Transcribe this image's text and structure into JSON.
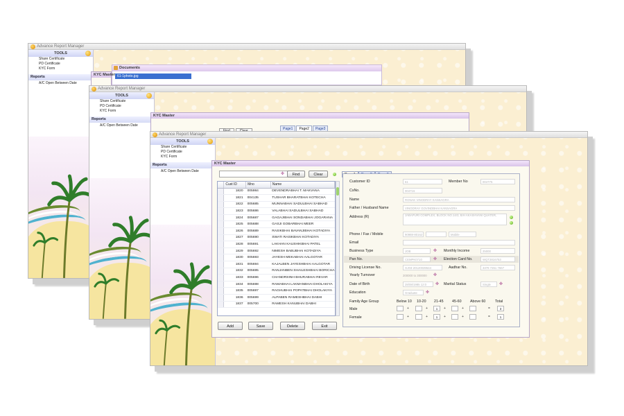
{
  "app_title": "Advance Report Manager",
  "tools": {
    "header": "TOOLS",
    "items": [
      "Share Certificate",
      "PD Certificate",
      "KYC Form"
    ]
  },
  "reports": {
    "header": "Reports",
    "items": [
      "A/C Open Between Date"
    ]
  },
  "documents_window": {
    "title": "Documents",
    "file": "61-1photo.jpg"
  },
  "kyc_title": "KYC Master",
  "tabs": [
    "Page1",
    "Page2",
    "Page3"
  ],
  "search": {
    "find_label": "Find",
    "clear_label": "Clear"
  },
  "grid": {
    "columns": [
      "Cust ID",
      "Mno",
      "Name"
    ],
    "rows": [
      [
        "1820",
        "005984",
        "DEVENDRABHAI T. MAKVANA"
      ],
      [
        "1821",
        "004135",
        "TUSHAR BHARATBHAI KOTECHA"
      ],
      [
        "1822",
        "005685",
        "MUNNABHAI SADULBHAI SABHAD"
      ],
      [
        "1823",
        "005686",
        "VALABHAI SADULBHAI SABHAD"
      ],
      [
        "1824",
        "005687",
        "GAGAJIBHAI SONDABHAI JOGARANA"
      ],
      [
        "1825",
        "005688",
        "GASJI GOBARBHAI MEER"
      ],
      [
        "1826",
        "005689",
        "RASIKBHAI BAVANJIBHAI KOTADIYA"
      ],
      [
        "1827",
        "005690",
        "SWATI RASIKBHAI KOTADIYA"
      ],
      [
        "1828",
        "005691",
        "LAKHAN KAUSHIKBHAI PATEL"
      ],
      [
        "1829",
        "005692",
        "NIMESH BABUBHAI KOTADIYA"
      ],
      [
        "1830",
        "005693",
        "JAYESH MEKABHAI AALGOTAR"
      ],
      [
        "1831",
        "005694",
        "KAJALBEN JAYESHBHAI AALGOTAR"
      ],
      [
        "1832",
        "005695",
        "RANJANBEN SHAILESHBHAI BORICHA"
      ],
      [
        "1833",
        "005696",
        "CHANDRSINH BHURABHAI REVAR"
      ],
      [
        "1834",
        "005698",
        "RAMABHAI LAKMANBHAI DHOLAKIYA"
      ],
      [
        "1835",
        "005697",
        "RAGHUBHAI POPATBHAI DHOLAKIYA"
      ],
      [
        "1836",
        "005699",
        "ALPABEN RAMESHBHAI DABHI"
      ],
      [
        "1837",
        "005700",
        "RAMESH KANUBHAI DABHI"
      ]
    ]
  },
  "buttons": {
    "add": "Add",
    "save": "Save",
    "delete": "Delete",
    "exit": "Exit"
  },
  "form": {
    "customer_id_label": "Customer ID",
    "customer_id_value": "61",
    "member_no_label": "Member No",
    "member_no_value": "004775",
    "csno_label": "CsNo.",
    "csno_value": "004716",
    "name_label": "Name",
    "name_value": "RONAK VINODRAY KANSAGRA",
    "father_label": "Father / Husband Name",
    "father_value": "VINODRAY GOVINDBHAI KANSAGRA",
    "address_label": "Address (R)",
    "address_value": "JABAPURI COMPLEX, BLOCK NO.14/3, B/H AKASHVANI QUATER,",
    "phone_label": "Phone / Fax / Mobile",
    "phone_value": "90988-80162",
    "mobile_placeholder": "Mobile",
    "email_label": "Email",
    "business_type_label": "Business Type",
    "business_type_value": "JOB",
    "monthly_income_label": "Monthly Income",
    "monthly_income_value": "25000",
    "pan_label": "Pan No.",
    "pan_value": "CEMPK0710",
    "election_label": "Election Card No.",
    "election_value": "WQT2816753",
    "driving_label": "Driving License No.",
    "driving_value": "GJ03-20120039644",
    "aadhar_label": "Aadhar No.",
    "aadhar_value": "3378 7261 7667",
    "turnover_label": "Yearly Turnover",
    "turnover_value": "200000 to 300000",
    "dob_label": "Date of Birth",
    "dob_value": "28/08/1985 12:0",
    "marital_label": "Marital Status",
    "marital_value": "Single",
    "education_label": "Education",
    "education_value": "Graduate",
    "family_group_label": "Family Age Group",
    "age_headers": [
      "Below 10",
      "10-20",
      "21-45",
      "45-60",
      "Above 60",
      "Total"
    ],
    "male_label": "Male",
    "female_label": "Female",
    "male_counts": [
      "",
      "",
      "1",
      "",
      "",
      "3"
    ],
    "female_counts": [
      "",
      "",
      "1",
      "",
      "",
      "1"
    ],
    "plus": "+",
    "equals": "="
  }
}
